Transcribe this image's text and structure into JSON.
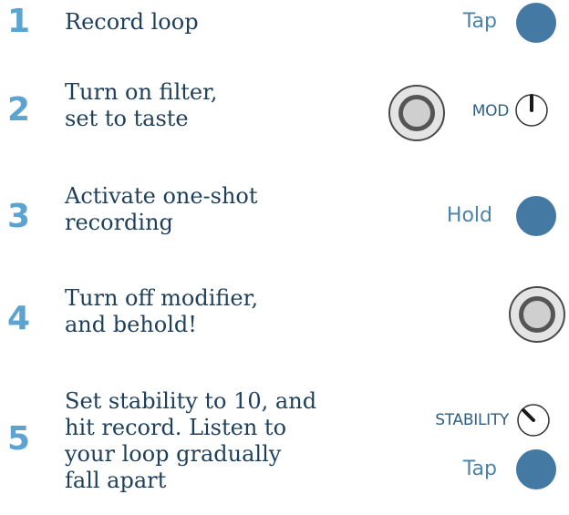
{
  "steps": [
    {
      "number": "1",
      "text": "Record loop",
      "control": {
        "label": "Tap",
        "type": "round-button"
      }
    },
    {
      "number": "2",
      "text": "Turn on filter,\nset to taste",
      "control": {
        "label": "MOD",
        "type": "ring-button-and-knob",
        "knob_position": "12 o'clock"
      }
    },
    {
      "number": "3",
      "text": "Activate one-shot\nrecording",
      "control": {
        "label": "Hold",
        "type": "round-button"
      }
    },
    {
      "number": "4",
      "text": "Turn off modifier,\nand behold!",
      "control": {
        "type": "ring-button"
      }
    },
    {
      "number": "5",
      "text": "Set stability to 10, and\nhit record. Listen to\nyour loop gradually\nfall apart",
      "control": {
        "knob_label": "STABILITY",
        "knob_position": "max",
        "button_label": "Tap",
        "type": "knob-and-round-button"
      }
    }
  ],
  "colors": {
    "step_number": "#5ba3d0",
    "step_text": "#1e3f5a",
    "control_label": "#4a83ab",
    "button_fill": "#4379a3"
  }
}
